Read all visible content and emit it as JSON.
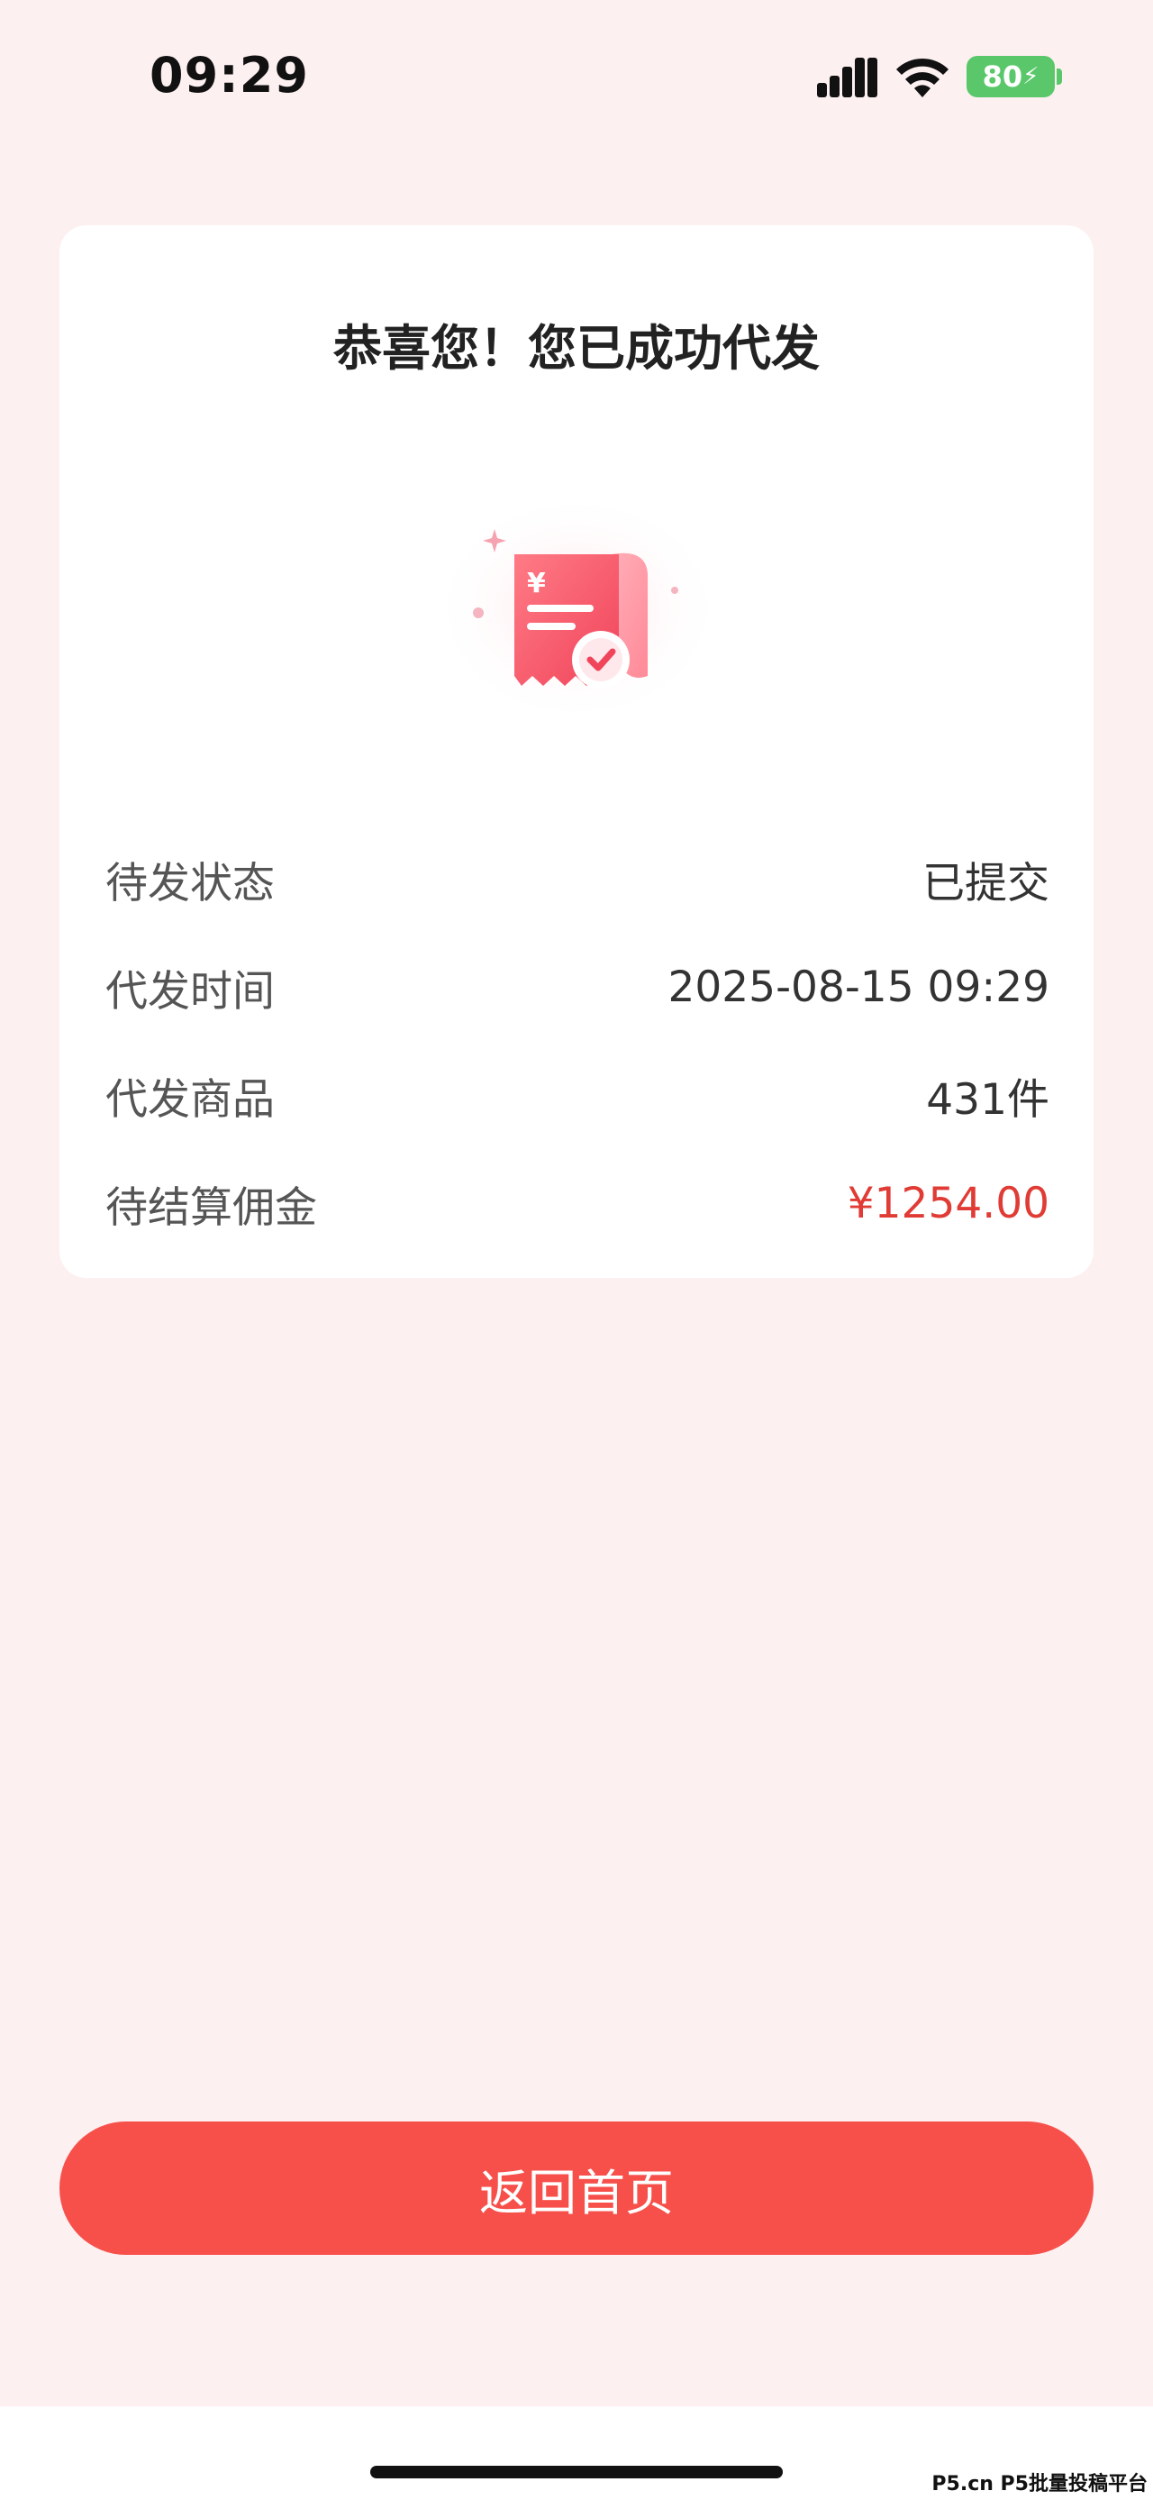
{
  "status_bar": {
    "time": "09:29",
    "battery": "80",
    "signal_icon": "cellular-signal-icon",
    "wifi_icon": "wifi-icon",
    "battery_icon": "battery-charging-icon"
  },
  "card": {
    "title": "恭喜您！您已成功代发",
    "illustration_icon": "receipt-check-icon",
    "rows": [
      {
        "label": "待发状态",
        "value": "已提交"
      },
      {
        "label": "代发时间",
        "value": "2025-08-15 09:29"
      },
      {
        "label": "代发商品",
        "value": "431件"
      },
      {
        "label": "待结算佣金",
        "value": "¥1254.00"
      }
    ]
  },
  "actions": {
    "home_label": "返回首页"
  },
  "watermark": "P5.cn P5批量投稿平台",
  "colors": {
    "background": "#fdf0f1",
    "accent": "#f7504b",
    "commission": "#e03c35"
  }
}
